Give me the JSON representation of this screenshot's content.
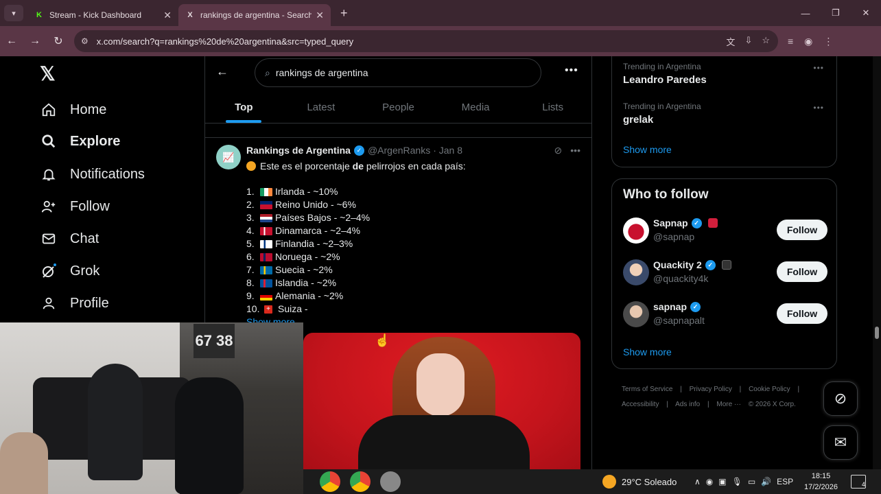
{
  "browser": {
    "tabs": [
      {
        "label": "Stream - Kick Dashboard",
        "favicon": "K",
        "active": false
      },
      {
        "label": "rankings de argentina - Search",
        "favicon": "X",
        "active": true
      }
    ],
    "url": "x.com/search?q=rankings%20de%20argentina&src=typed_query"
  },
  "nav": {
    "items": [
      {
        "label": "Home",
        "icon": "home-icon"
      },
      {
        "label": "Explore",
        "icon": "search-icon"
      },
      {
        "label": "Notifications",
        "icon": "bell-icon"
      },
      {
        "label": "Follow",
        "icon": "person-add-icon"
      },
      {
        "label": "Chat",
        "icon": "mail-icon"
      },
      {
        "label": "Grok",
        "icon": "grok-icon"
      },
      {
        "label": "Profile",
        "icon": "person-icon"
      }
    ]
  },
  "search": {
    "query": "rankings de argentina",
    "tabs": [
      "Top",
      "Latest",
      "People",
      "Media",
      "Lists"
    ]
  },
  "tweet": {
    "name": "Rankings de Argentina",
    "handle": "@ArgenRanks",
    "date": "· Jan 8",
    "intro_pre": "Este es el porcentaje ",
    "intro_bold": "de",
    "intro_post": " pelirrojos en cada país:",
    "rankings": [
      {
        "n": "1.",
        "text": "Irlanda - ~10%"
      },
      {
        "n": "2.",
        "text": "Reino Unido - ~6%"
      },
      {
        "n": "3.",
        "text": "Países Bajos - ~2–4%"
      },
      {
        "n": "4.",
        "text": "Dinamarca - ~2–4%"
      },
      {
        "n": "5.",
        "text": "Finlandia - ~2–3%"
      },
      {
        "n": "6.",
        "text": "Noruega - ~2%"
      },
      {
        "n": "7.",
        "text": "Suecia - ~2%"
      },
      {
        "n": "8.",
        "text": "Islandia - ~2%"
      },
      {
        "n": "9.",
        "text": "Alemania - ~2%"
      },
      {
        "n": "10.",
        "text": "Suiza -"
      }
    ],
    "show_more": "Show more"
  },
  "trending": [
    {
      "context": "Trending in Argentina",
      "topic": "Leandro Paredes"
    },
    {
      "context": "Trending in Argentina",
      "topic": "grelak"
    }
  ],
  "trending_show_more": "Show more",
  "who_to_follow": {
    "title": "Who to follow",
    "accounts": [
      {
        "name": "Sapnap",
        "handle": "@sapnap",
        "button": "Follow"
      },
      {
        "name": "Quackity 2",
        "handle": "@quackity4k",
        "button": "Follow"
      },
      {
        "name": "sapnap",
        "handle": "@sapnapalt",
        "button": "Follow"
      }
    ],
    "show_more": "Show more"
  },
  "footer": {
    "line1": [
      "Terms of Service",
      "|",
      "Privacy Policy",
      "|",
      "Cookie Policy",
      "|"
    ],
    "line2": [
      "Accessibility",
      "|",
      "Ads info",
      "|",
      "More ···",
      "© 2026 X Corp."
    ]
  },
  "webcam": {
    "jersey": "67 38"
  },
  "taskbar": {
    "weather": "29°C Soleado",
    "lang": "ESP",
    "time": "18:15",
    "date": "17/2/2026",
    "notif_count": "4"
  },
  "colors": {
    "accent": "#1d9bf0",
    "tab_bg": "#3b2630",
    "toolbar_bg": "#5a3646"
  }
}
